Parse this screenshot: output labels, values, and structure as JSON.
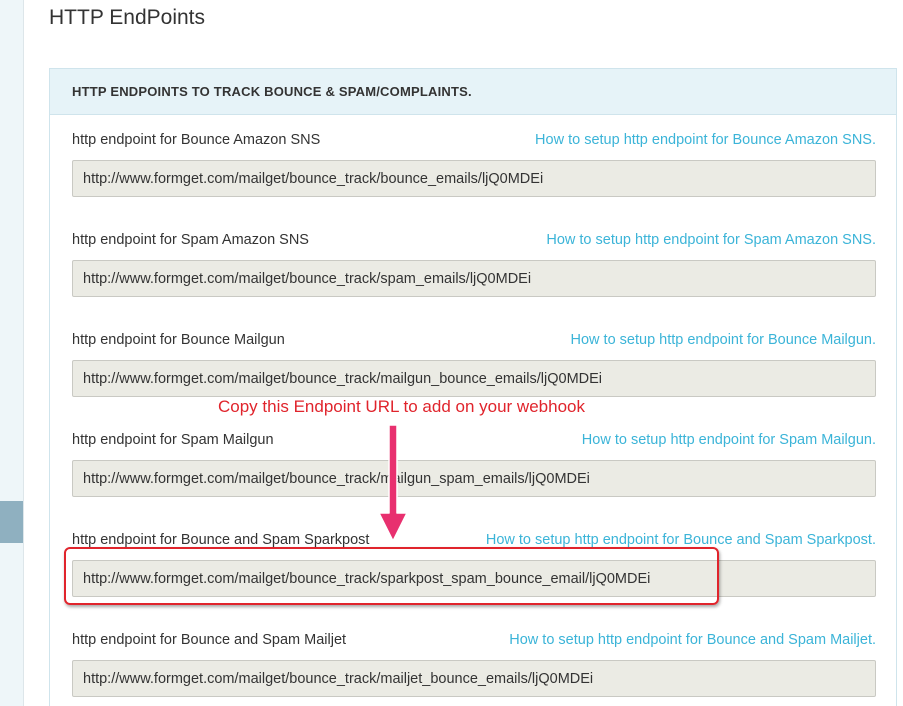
{
  "page": {
    "title": "HTTP EndPoints"
  },
  "panel": {
    "header": "HTTP ENDPOINTS TO TRACK BOUNCE & SPAM/COMPLAINTS."
  },
  "endpoints": [
    {
      "label": "http endpoint for Bounce Amazon SNS",
      "link": "How to setup http endpoint for Bounce Amazon SNS.",
      "url": "http://www.formget.com/mailget/bounce_track/bounce_emails/ljQ0MDEi"
    },
    {
      "label": "http endpoint for Spam Amazon SNS",
      "link": "How to setup http endpoint for Spam Amazon SNS.",
      "url": "http://www.formget.com/mailget/bounce_track/spam_emails/ljQ0MDEi"
    },
    {
      "label": "http endpoint for Bounce Mailgun",
      "link": "How to setup http endpoint for Bounce Mailgun.",
      "url": "http://www.formget.com/mailget/bounce_track/mailgun_bounce_emails/ljQ0MDEi"
    },
    {
      "label": "http endpoint for Spam Mailgun",
      "link": "How to setup http endpoint for Spam Mailgun.",
      "url": "http://www.formget.com/mailget/bounce_track/mailgun_spam_emails/ljQ0MDEi"
    },
    {
      "label": "http endpoint for Bounce and Spam Sparkpost",
      "link": "How to setup http endpoint for Bounce and Spam Sparkpost.",
      "url": "http://www.formget.com/mailget/bounce_track/sparkpost_spam_bounce_email/ljQ0MDEi"
    },
    {
      "label": "http endpoint for Bounce and Spam Mailjet",
      "link": "How to setup http endpoint for Bounce and Spam Mailjet.",
      "url": "http://www.formget.com/mailget/bounce_track/mailjet_bounce_emails/ljQ0MDEi"
    }
  ],
  "annotation": {
    "callout": "Copy this Endpoint URL to add on your webhook",
    "color": "#e0242c"
  },
  "colors": {
    "link": "#3bb4d8",
    "panel_header_bg": "#e6f3f8",
    "field_bg": "#ebebe4"
  }
}
